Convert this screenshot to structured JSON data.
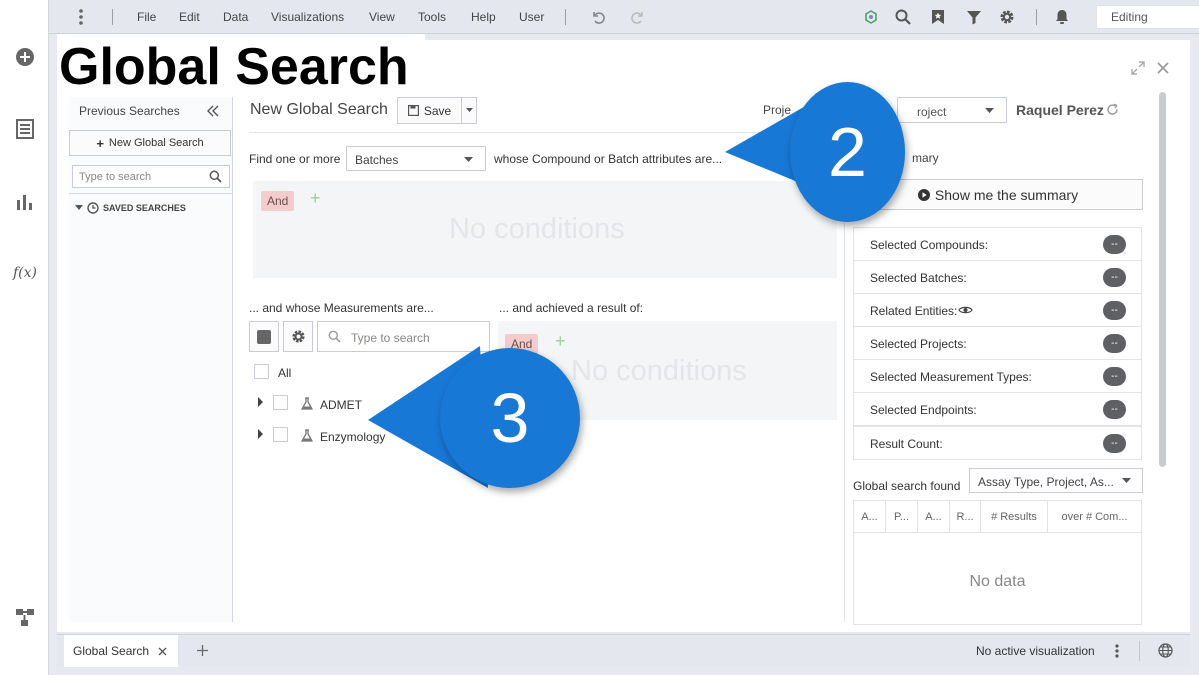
{
  "page_title": "Global Search",
  "menubar": {
    "items": [
      "File",
      "Edit",
      "Data",
      "Visualizations",
      "View",
      "Tools",
      "Help",
      "User"
    ],
    "mode": "Editing"
  },
  "search": {
    "header_title": "New Global Search",
    "save_label": "Save",
    "project_label": "Proje",
    "project_value": "roject",
    "user_name": "Raquel Perez",
    "find_one_or_more": "Find one or more",
    "entity_type": "Batches",
    "attributes_label": "whose Compound or Batch attributes are...",
    "and_label": "And",
    "no_conditions": "No conditions",
    "measurements_label": "... and whose Measurements are...",
    "result_label": "... and achieved a result of:",
    "measure_search_placeholder": "Type to search",
    "tree_all": "All",
    "tree_items": [
      "ADMET",
      "Enzymology"
    ]
  },
  "previous_searches": {
    "title": "Previous Searches",
    "new_button": "New Global Search",
    "search_placeholder": "Type to search",
    "saved_label": "SAVED SEARCHES"
  },
  "summary": {
    "title": "mary",
    "button": "Show me the summary",
    "rows": [
      {
        "label": "Selected Compounds:",
        "value": "--"
      },
      {
        "label": "Selected Batches:",
        "value": "--"
      },
      {
        "label": "Related Entities:",
        "value": "--"
      },
      {
        "label": "Selected Projects:",
        "value": "--"
      },
      {
        "label": "Selected Measurement Types:",
        "value": "--"
      },
      {
        "label": "Selected Endpoints:",
        "value": "--"
      },
      {
        "label": "Result Count:",
        "value": "--"
      }
    ],
    "found_label": "Global search found",
    "found_select": "Assay Type, Project, As...",
    "columns": [
      "A...",
      "P...",
      "A...",
      "R...",
      "# Results",
      "over # Com..."
    ],
    "no_data": "No data"
  },
  "bottom": {
    "tab_label": "Global Search",
    "status": "No active visualization"
  },
  "callouts": [
    "2",
    "3"
  ],
  "colors": {
    "accent": "#1878d6",
    "and_badge": "#f4cccc",
    "pill": "#5e6063"
  }
}
